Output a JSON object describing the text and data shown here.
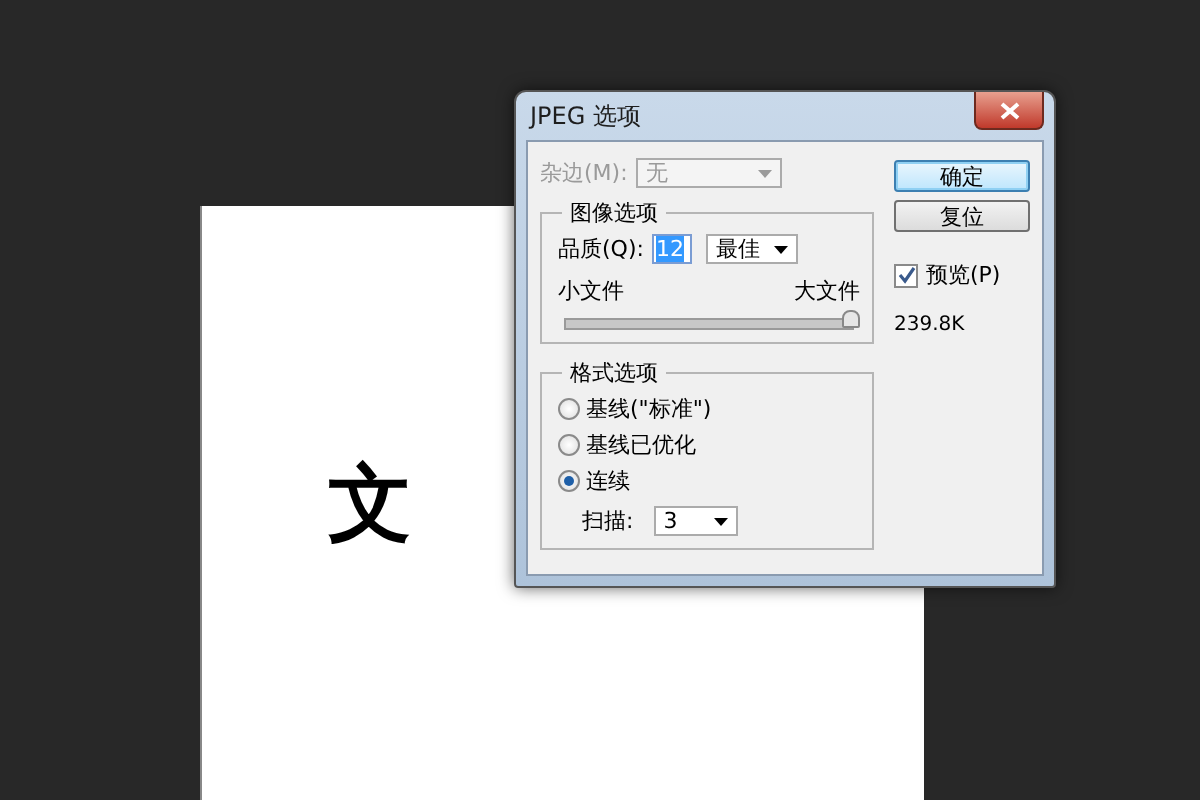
{
  "canvas": {
    "text": "文"
  },
  "dialog": {
    "title": "JPEG 选项"
  },
  "matte": {
    "label": "杂边(M):",
    "value": "无",
    "disabled": true
  },
  "image_options": {
    "title": "图像选项",
    "quality_label": "品质(Q):",
    "quality_value": "12",
    "quality_value_selected": true,
    "quality_preset": "最佳",
    "small_label": "小文件",
    "large_label": "大文件",
    "level": 1.0
  },
  "format_options": {
    "title": "格式选项",
    "options": [
      {
        "label": "基线(\"标准\")",
        "selected": false
      },
      {
        "label": "基线已优化",
        "selected": false
      },
      {
        "label": "连续",
        "selected": true
      }
    ],
    "scan_label": "扫描:",
    "scan_value": "3"
  },
  "buttons": [
    {
      "label": "确定",
      "default": true
    },
    {
      "label": "复位",
      "default": false
    }
  ],
  "preview": {
    "label": "预览(P)",
    "checked": true
  },
  "file_size": "239.8K"
}
